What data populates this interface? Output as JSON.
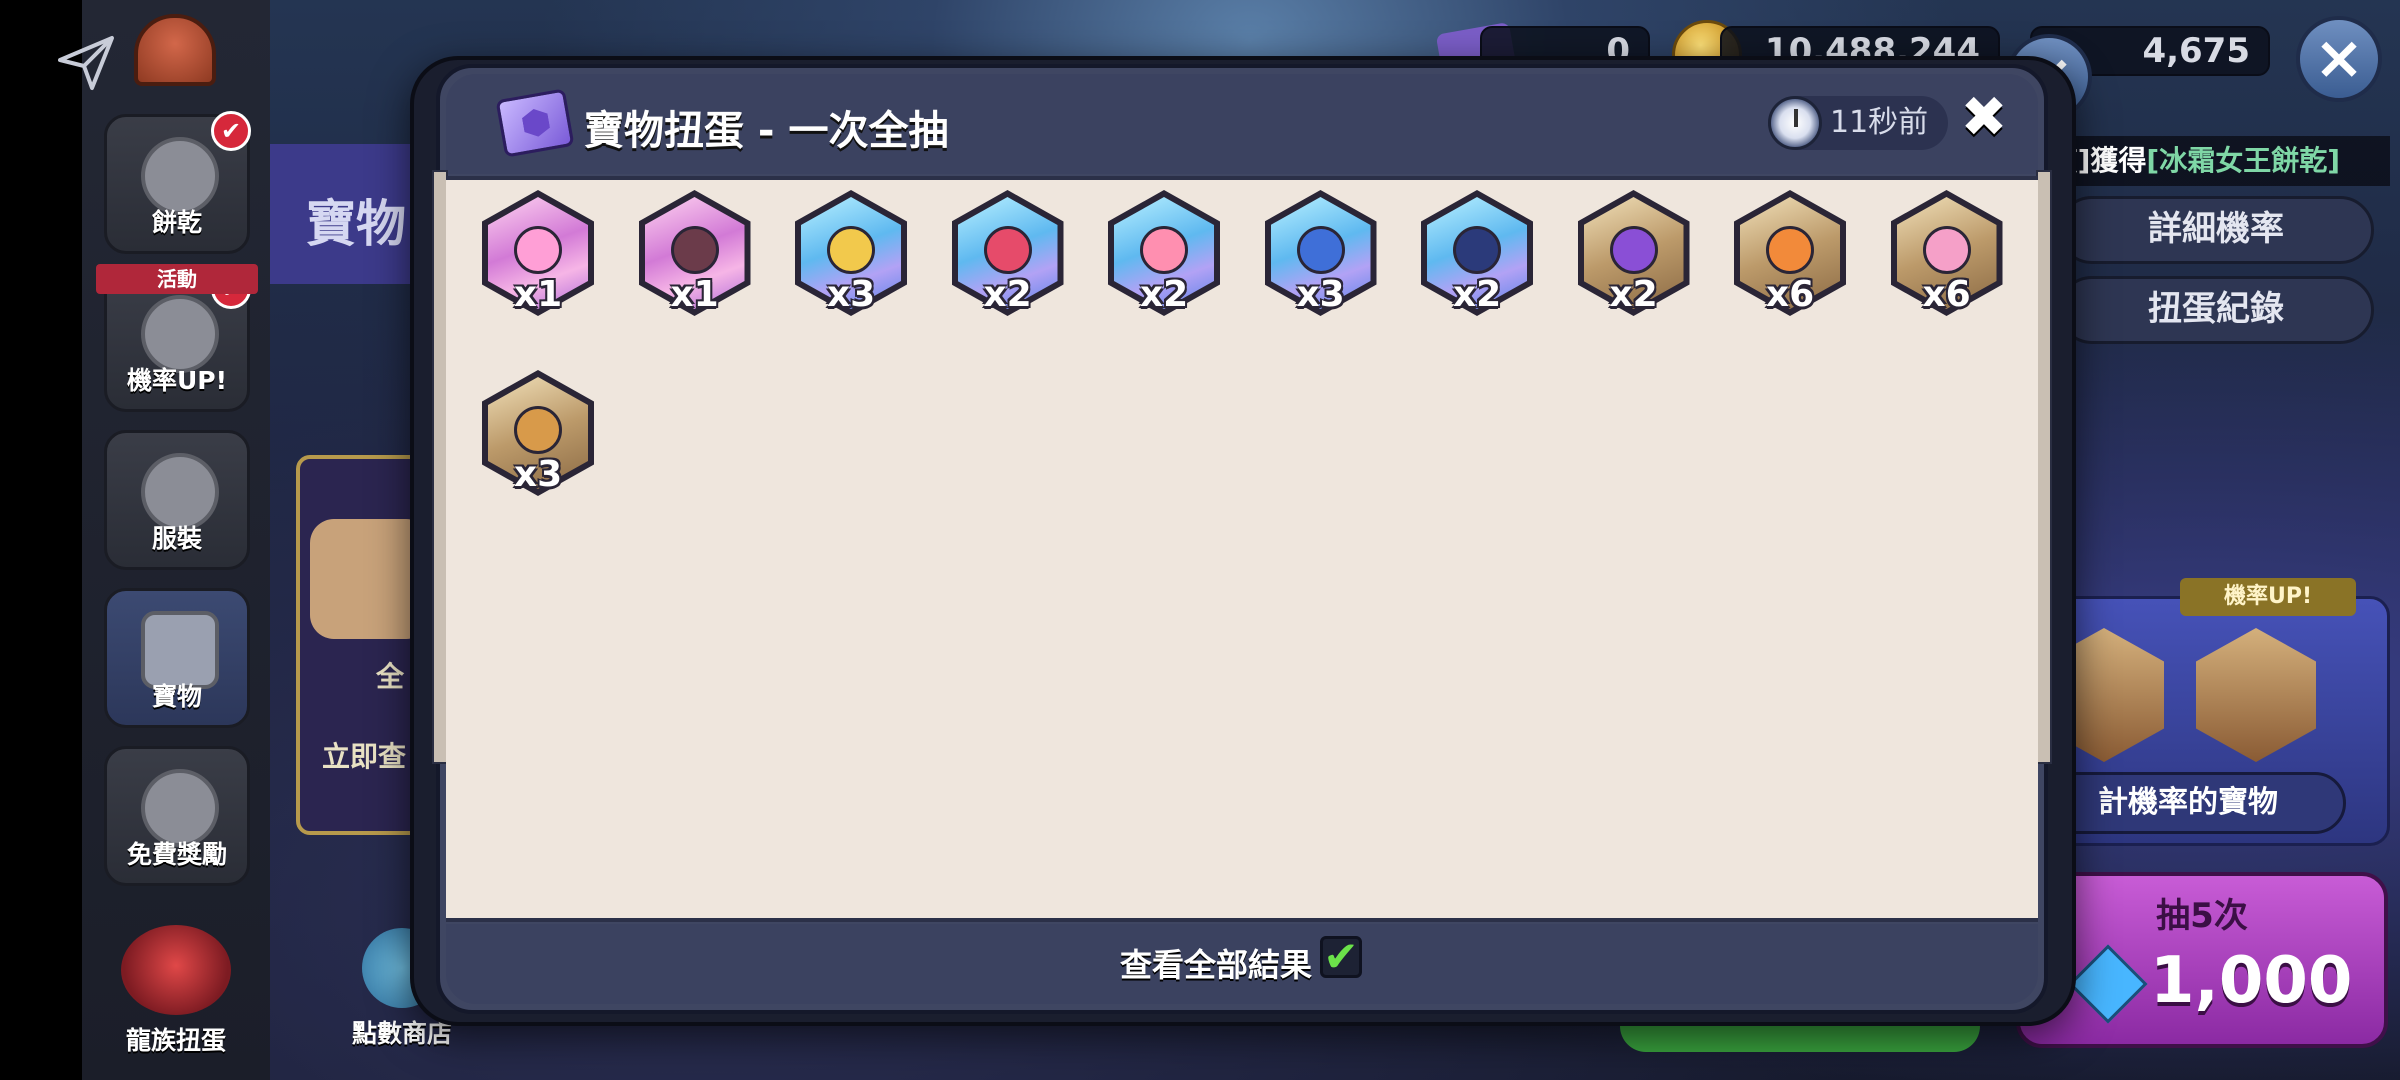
{
  "background": {
    "currency": {
      "left_value": "0",
      "mid_value": "10,488,244",
      "right_value": "4,675"
    },
    "title_partial": "寶物",
    "card_label_1": "全",
    "card_label_2": "立即查",
    "points_shop_label": "點數商店",
    "notice": {
      "prefix": "[蛋煎煎]獲得",
      "item": "[冰霜女王餅乾]"
    },
    "right_buttons": [
      {
        "label": "詳細機率"
      },
      {
        "label": "扭蛋紀錄"
      }
    ],
    "rateup_tag": "機率UP!",
    "rateup_button": "計機率的寶物",
    "pull": {
      "label": "抽5次",
      "cost": "1,000"
    }
  },
  "sidebar": {
    "items": [
      {
        "label": "餅乾"
      },
      {
        "label": "機率UP!",
        "ribbon": "活動"
      },
      {
        "label": "服裝"
      },
      {
        "label": "寶物"
      },
      {
        "label": "免費獎勵"
      },
      {
        "label": "龍族扭蛋"
      }
    ]
  },
  "modal": {
    "title": "寶物扭蛋 - 一次全抽",
    "time_ago": "11秒前",
    "close_symbol": "✖",
    "footer_label": "查看全部結果",
    "footer_check": "✔",
    "rewards": [
      {
        "qty": "x1",
        "rarity": "pink",
        "icon": "pink-cat-treasure-icon",
        "art_color": "#ff9fd6"
      },
      {
        "qty": "x1",
        "rarity": "pink",
        "icon": "dark-fruit-treasure-icon",
        "art_color": "#6b3b4a"
      },
      {
        "qty": "x3",
        "rarity": "blue",
        "icon": "golden-horn-treasure-icon",
        "art_color": "#f2c94c"
      },
      {
        "qty": "x2",
        "rarity": "blue",
        "icon": "red-scroll-treasure-icon",
        "art_color": "#e64b6a"
      },
      {
        "qty": "x2",
        "rarity": "blue",
        "icon": "pink-bird-treasure-icon",
        "art_color": "#ff8fb0"
      },
      {
        "qty": "x3",
        "rarity": "blue",
        "icon": "blue-wrench-treasure-icon",
        "art_color": "#3f6fd8"
      },
      {
        "qty": "x2",
        "rarity": "blue",
        "icon": "dark-crystal-treasure-icon",
        "art_color": "#2b3a7a"
      },
      {
        "qty": "x2",
        "rarity": "gold",
        "icon": "purple-scroll-treasure-icon",
        "art_color": "#8a4fd6"
      },
      {
        "qty": "x6",
        "rarity": "gold",
        "icon": "orange-pot-treasure-icon",
        "art_color": "#f28a3a"
      },
      {
        "qty": "x6",
        "rarity": "gold",
        "icon": "pink-clock-treasure-icon",
        "art_color": "#f5a0c8"
      },
      {
        "qty": "x3",
        "rarity": "gold",
        "icon": "treasure-chest-icon",
        "art_color": "#d89a4a"
      }
    ]
  }
}
